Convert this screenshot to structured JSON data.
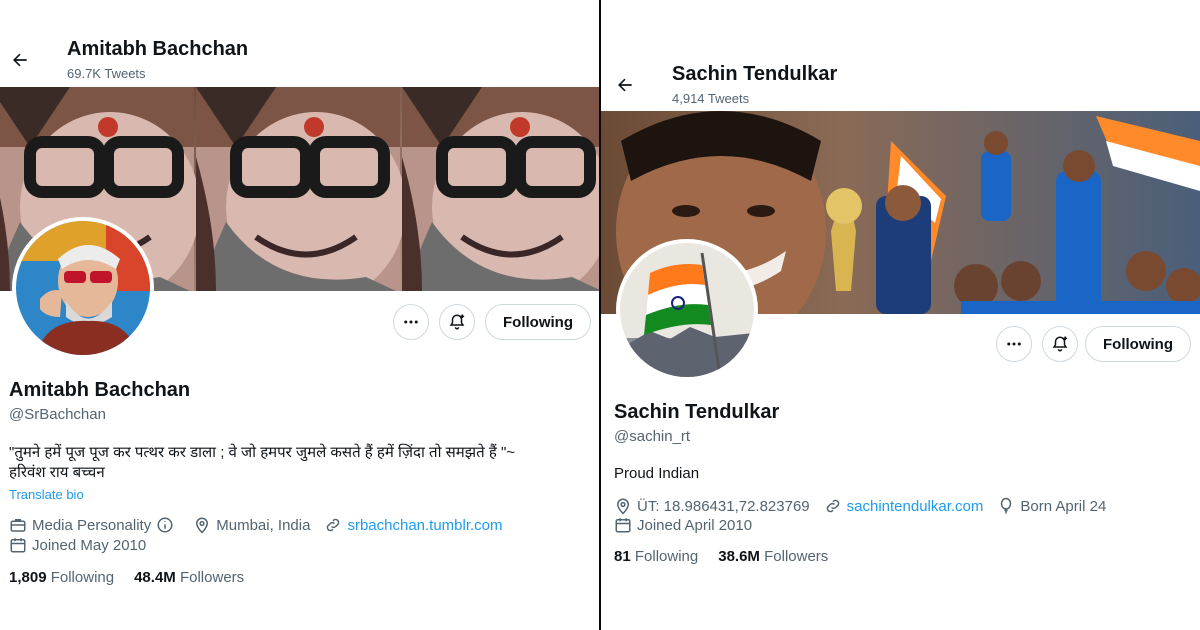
{
  "left": {
    "header_name": "Amitabh Bachchan",
    "header_count": "69.7K Tweets",
    "display_name": "Amitabh Bachchan",
    "handle": "@SrBachchan",
    "bio_line1": "\"तुमने हमें पूज पूज कर पत्थर कर डाला ; वे जो हमपर जुमले कसते हैं हमें ज़िंदा तो समझते हैं \"~",
    "bio_line2": "हरिवंश राय  बच्चन",
    "translate_label": "Translate bio",
    "category": "Media Personality",
    "location": "Mumbai, India",
    "website": "srbachchan.tumblr.com",
    "joined": "Joined May 2010",
    "following_count": "1,809",
    "following_label": "Following",
    "followers_count": "48.4M",
    "followers_label": "Followers",
    "follow_button": "Following"
  },
  "right": {
    "header_name": "Sachin Tendulkar",
    "header_count": "4,914 Tweets",
    "display_name": "Sachin Tendulkar",
    "handle": "@sachin_rt",
    "bio": "Proud Indian",
    "location": "ÜT: 18.986431,72.823769",
    "website": "sachintendulkar.com",
    "birthday": "Born April 24",
    "joined": "Joined April 2010",
    "following_count": "81",
    "following_label": "Following",
    "followers_count": "38.6M",
    "followers_label": "Followers",
    "follow_button": "Following"
  },
  "colors": {
    "accent": "#1d9bf0",
    "muted": "#536471",
    "text": "#0f1419",
    "border": "#cfd9de"
  }
}
